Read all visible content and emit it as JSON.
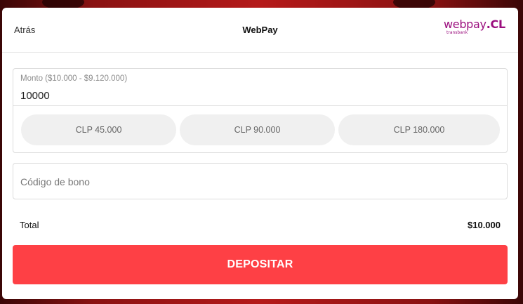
{
  "header": {
    "back_label": "Atrás",
    "title": "WebPay",
    "logo": {
      "main": "webpay",
      "suffix": ".CL",
      "sub": "transbank"
    }
  },
  "amount": {
    "label": "Monto ($10.000 - $9.120.000)",
    "value": "10000",
    "presets": [
      "CLP 45.000",
      "CLP 90.000",
      "CLP 180.000"
    ]
  },
  "bonus": {
    "placeholder": "Código de bono",
    "value": ""
  },
  "total": {
    "label": "Total",
    "value": "$10.000"
  },
  "deposit_label": "DEPOSITAR",
  "colors": {
    "accent": "#fe4045",
    "logo": "#9b0e7e",
    "preset_bg": "#f0f0f0"
  }
}
